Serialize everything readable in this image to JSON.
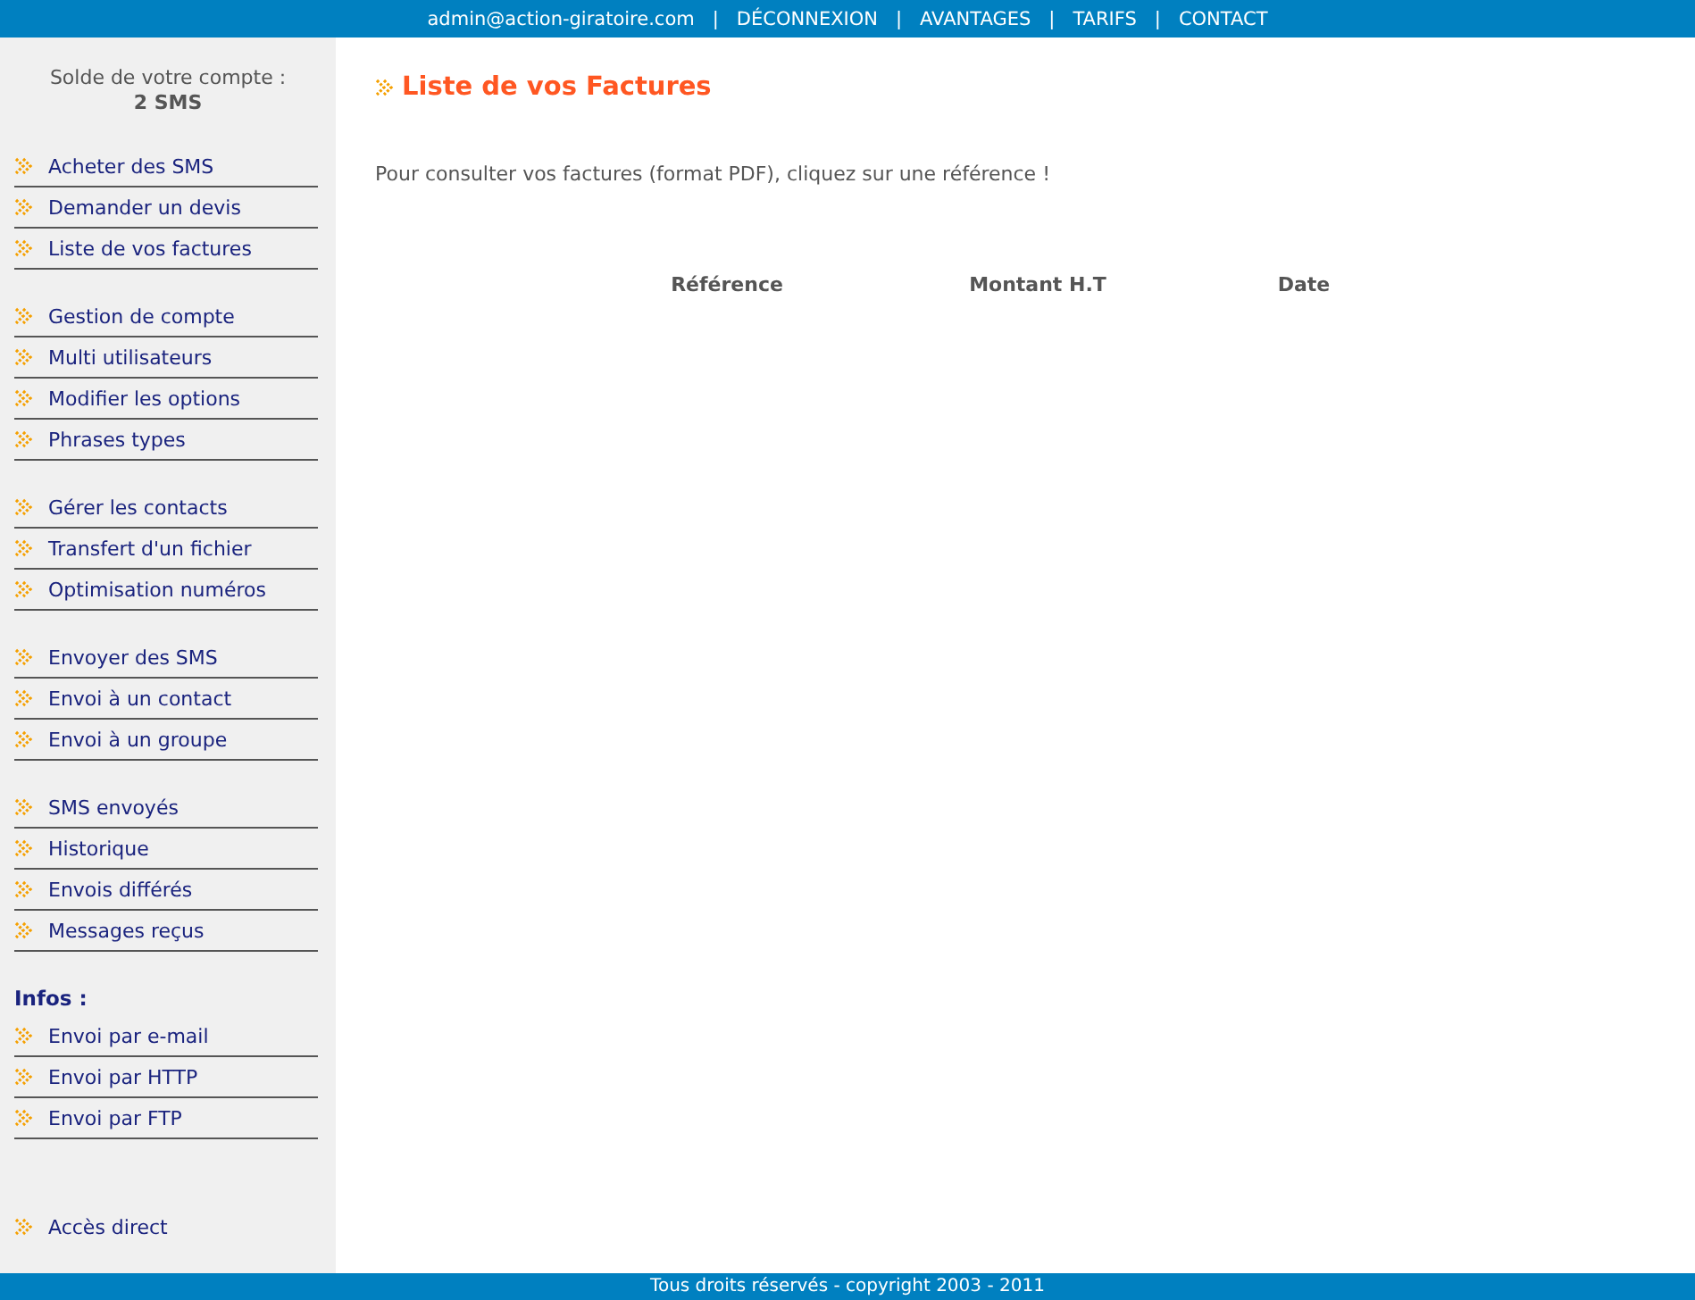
{
  "top_bar": {
    "email": "admin@action-giratoire.com",
    "separator": "|",
    "links": [
      "DÉCONNEXION",
      "AVANTAGES",
      "TARIFS",
      "CONTACT"
    ]
  },
  "sidebar": {
    "balance_label": "Solde de votre compte :",
    "balance_value": "2 SMS",
    "groups": [
      {
        "items": [
          "Acheter des SMS",
          "Demander un devis",
          "Liste de vos factures"
        ]
      },
      {
        "items": [
          "Gestion de compte",
          "Multi utilisateurs",
          "Modifier les options",
          "Phrases types"
        ]
      },
      {
        "items": [
          "Gérer les contacts",
          "Transfert d'un fichier",
          "Optimisation numéros"
        ]
      },
      {
        "items": [
          "Envoyer des SMS",
          "Envoi à un contact",
          "Envoi à un groupe"
        ]
      },
      {
        "items": [
          "SMS envoyés",
          "Historique",
          "Envois différés",
          "Messages reçus"
        ]
      },
      {
        "heading": "Infos :",
        "items": [
          "Envoi par e-mail",
          "Envoi par HTTP",
          "Envoi par FTP"
        ]
      }
    ],
    "direct_link": "Accès direct"
  },
  "main": {
    "title": "Liste de vos Factures",
    "intro": "Pour consulter vos factures (format PDF), cliquez sur une référence !",
    "table": {
      "columns": [
        "Référence",
        "Montant H.T",
        "Date"
      ]
    }
  },
  "footer": "Tous droits réservés - copyright 2003 - 2011"
}
